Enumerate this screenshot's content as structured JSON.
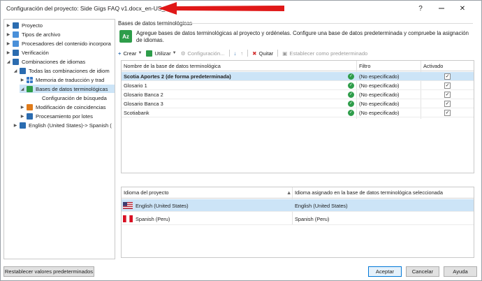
{
  "window": {
    "title": "Configuración del proyecto: Side Gigs FAQ v1.docx_en-US_es-PE",
    "help_glyph": "?",
    "close_glyph": "✕"
  },
  "tree": {
    "items": [
      {
        "label": "Proyecto",
        "icon": "project-icon"
      },
      {
        "label": "Tipos de archivo",
        "icon": "file-types-icon"
      },
      {
        "label": "Procesadores del contenido incorpora",
        "icon": "processor-icon"
      },
      {
        "label": "Verificación",
        "icon": "verification-icon"
      },
      {
        "label": "Combinaciones de idiomas",
        "icon": "language-pairs-icon"
      },
      {
        "label": "Todas las combinaciones de idiom",
        "icon": "all-pairs-icon"
      },
      {
        "label": "Memoria de traducción y trad",
        "icon": "tm-icon"
      },
      {
        "label": "Bases de datos terminológicas",
        "icon": "termbase-icon"
      },
      {
        "label": "Configuración de búsqueda",
        "icon": ""
      },
      {
        "label": "Modificación de coincidencias",
        "icon": "wrench-icon"
      },
      {
        "label": "Procesamiento por lotes",
        "icon": "batch-icon"
      },
      {
        "label": "English (United States)-> Spanish (",
        "icon": "language-pair-icon"
      }
    ]
  },
  "panel": {
    "title": "Bases de datos terminológicas",
    "description": "Agregue bases de datos terminológicas al proyecto y ordénelas. Configure una base de datos predeterminada y compruebe la asignación de idiomas."
  },
  "toolbar": {
    "create": "Crear",
    "use": "Utilizar",
    "settings": "Configuración...",
    "remove": "Quitar",
    "set_default": "Establecer como predeterminado"
  },
  "termbases": {
    "headers": [
      "Nombre de la base de datos terminológica",
      "Filtro",
      "Activado"
    ],
    "rows": [
      {
        "name": "Scotia Aportes 2 (de forma predeterminada)",
        "filter": "(No especificado)",
        "enabled": "✓"
      },
      {
        "name": "Glosario 1",
        "filter": "(No especificado)",
        "enabled": "✓"
      },
      {
        "name": "Glosario Banca 2",
        "filter": "(No especificado)",
        "enabled": "✓"
      },
      {
        "name": "Glosario Banca 3",
        "filter": "(No especificado)",
        "enabled": "✓"
      },
      {
        "name": "Scotiabank",
        "filter": "(No especificado)",
        "enabled": "✓"
      }
    ]
  },
  "languages": {
    "headers": [
      "Idioma del proyecto",
      "Idioma asignado en la base de datos terminológica seleccionada"
    ],
    "rows": [
      {
        "project": "English (United States)",
        "assigned": "English (United States)",
        "flag": "us-flag-icon"
      },
      {
        "project": "Spanish (Peru)",
        "assigned": "Spanish (Peru)",
        "flag": "peru-flag-icon"
      }
    ]
  },
  "buttons": {
    "reset": "Restablecer valores predeterminados",
    "ok": "Aceptar",
    "cancel": "Cancelar",
    "help": "Ayuda"
  },
  "colors": {
    "selection": "#cce4f7",
    "accent_green": "#2e9d4a",
    "arrow_red": "#e01818"
  }
}
